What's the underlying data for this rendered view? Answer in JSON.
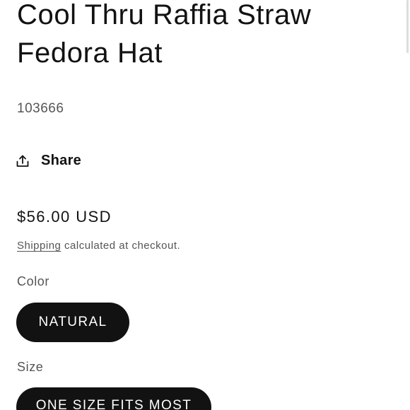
{
  "product": {
    "title": "Cool Thru Raffia Straw Fedora Hat",
    "sku": "103666",
    "share_label": "Share",
    "share_icon": "share-upload-icon",
    "price": "$56.00 USD",
    "shipping_link": "Shipping",
    "shipping_text": " calculated at checkout."
  },
  "options": {
    "color": {
      "label": "Color",
      "selected": "NATURAL"
    },
    "size": {
      "label": "Size",
      "selected": "ONE SIZE FITS MOST"
    }
  },
  "colors": {
    "text": "#121212",
    "muted": "#555555",
    "pill_bg": "#121212",
    "pill_text": "#ffffff",
    "background": "#ffffff"
  }
}
